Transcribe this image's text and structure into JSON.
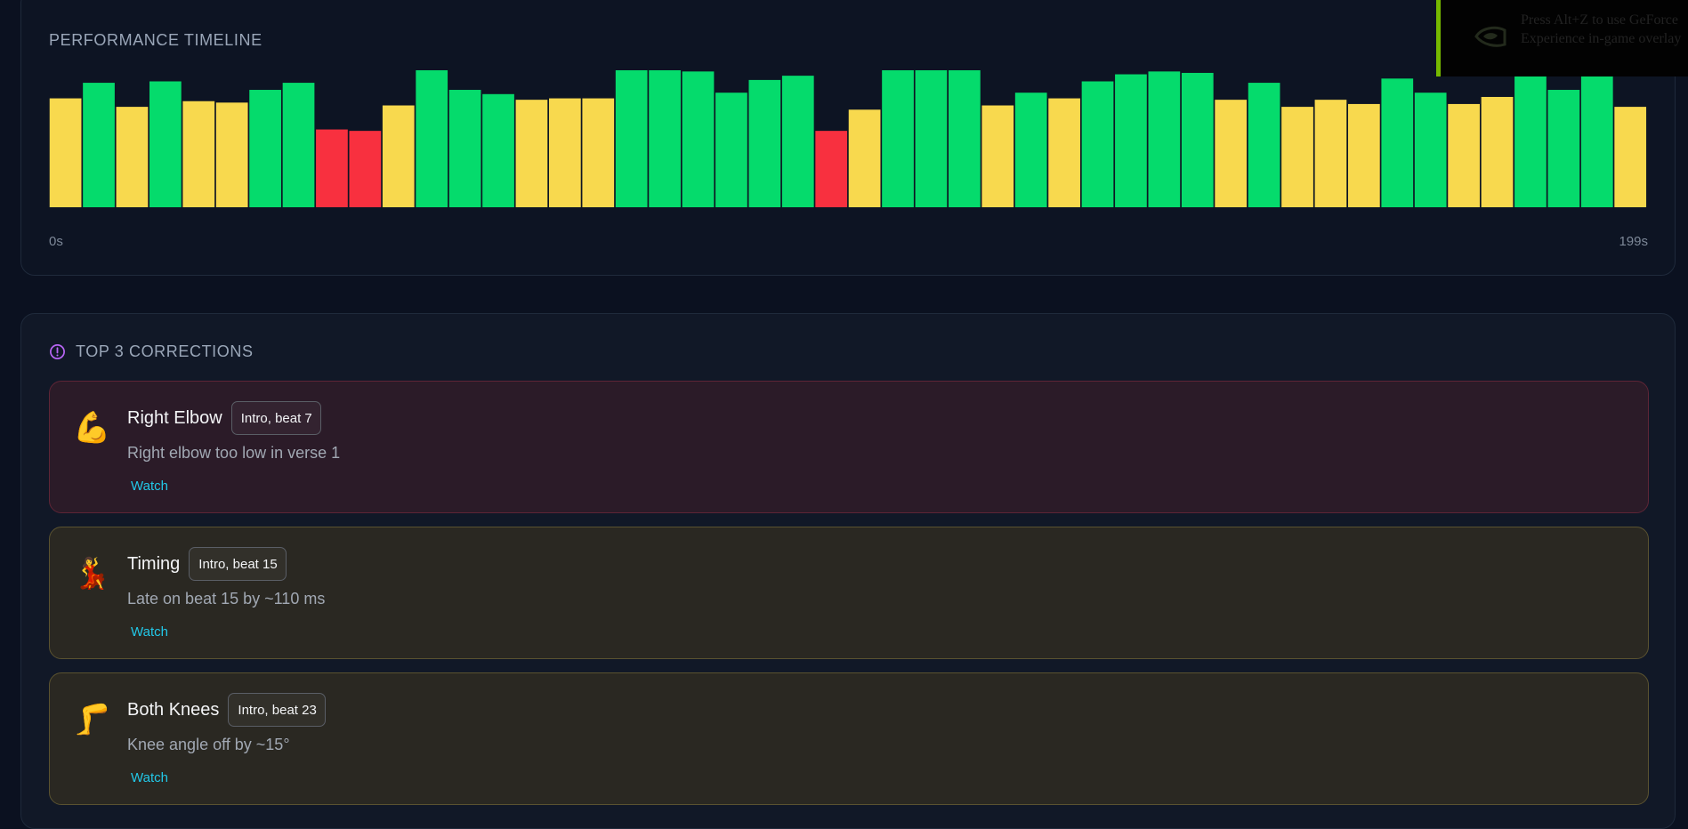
{
  "timeline": {
    "title": "PERFORMANCE TIMELINE",
    "axis_start": "0s",
    "axis_end": "199s"
  },
  "colors": {
    "good": "#05db6c",
    "ok": "#f8d94e",
    "bad": "#f8303f",
    "accent_watch": "#22c8e8",
    "overlay_accent": "#76b900"
  },
  "chart_data": {
    "type": "bar",
    "ylim": [
      0,
      100
    ],
    "levels": [
      "bad",
      "ok",
      "good"
    ],
    "values": [
      77,
      88,
      71,
      89,
      75,
      74,
      83,
      88,
      55,
      54,
      72,
      97,
      83,
      80,
      76,
      77,
      77,
      99,
      98,
      96,
      81,
      90,
      93,
      54,
      69,
      98,
      97,
      99,
      72,
      81,
      77,
      89,
      94,
      96,
      95,
      76,
      88,
      71,
      76,
      73,
      91,
      81,
      73,
      78,
      97,
      83,
      97,
      71
    ],
    "status": [
      "ok",
      "good",
      "ok",
      "good",
      "ok",
      "ok",
      "good",
      "good",
      "bad",
      "bad",
      "ok",
      "good",
      "good",
      "good",
      "ok",
      "ok",
      "ok",
      "good",
      "good",
      "good",
      "good",
      "good",
      "good",
      "bad",
      "ok",
      "good",
      "good",
      "good",
      "ok",
      "good",
      "ok",
      "good",
      "good",
      "good",
      "good",
      "ok",
      "good",
      "ok",
      "ok",
      "ok",
      "good",
      "good",
      "ok",
      "ok",
      "good",
      "good",
      "good",
      "ok"
    ]
  },
  "overlay": {
    "text": "Press Alt+Z to use GeForce Experience in-game overlay",
    "icon": "nvidia-logo-icon"
  },
  "corrections": {
    "title": "TOP 3 CORRECTIONS",
    "icon": "alert-circle-icon",
    "items": [
      {
        "emoji": "💪",
        "title": "Right Elbow",
        "badge": "Intro, beat 7",
        "description": "Right elbow too low in verse 1",
        "action": "Watch",
        "severity": "red"
      },
      {
        "emoji": "💃",
        "title": "Timing",
        "badge": "Intro, beat 15",
        "description": "Late on beat 15 by ~110 ms",
        "action": "Watch",
        "severity": "yellow"
      },
      {
        "emoji": "🦵",
        "title": "Both Knees",
        "badge": "Intro, beat 23",
        "description": "Knee angle off by ~15°",
        "action": "Watch",
        "severity": "yellow"
      }
    ]
  }
}
